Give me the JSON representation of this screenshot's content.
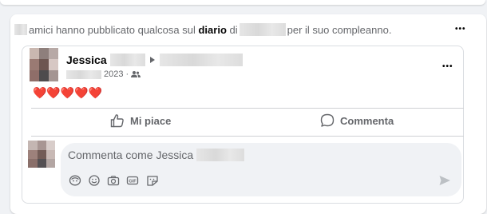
{
  "notification": {
    "text_before": "amici hanno pubblicato qualcosa sul",
    "bold_word": "diario",
    "text_middle": "di",
    "text_after": "per il suo compleanno.",
    "more_label": "•••"
  },
  "post": {
    "author_first_name": "Jessica",
    "date_year": "2023",
    "date_separator": "·",
    "audience_icon": "friends-icon",
    "content": "❤️❤️❤️❤️❤️",
    "more_label": "•••"
  },
  "actions": {
    "like_label": "Mi piace",
    "comment_label": "Commenta"
  },
  "comment_input": {
    "placeholder": "Commenta come Jessica",
    "toolbar_icons": [
      "avatar-sticker-icon",
      "emoji-icon",
      "camera-icon",
      "gif-icon",
      "sticker-icon"
    ],
    "send_icon": "send-icon"
  },
  "colors": {
    "heart": "#e41e3f",
    "secondary_text": "#65676b",
    "page_background": "#f0f2f5"
  }
}
